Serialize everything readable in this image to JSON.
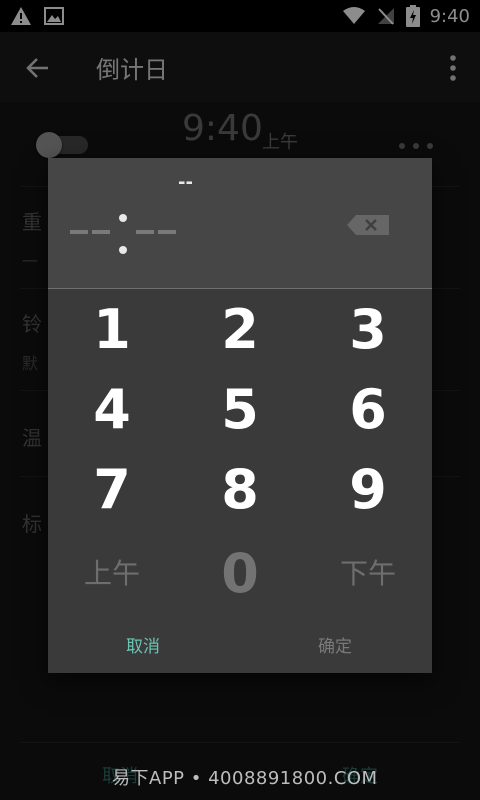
{
  "status_bar": {
    "time": "9:40"
  },
  "app_bar": {
    "title": "倒计日"
  },
  "alarm": {
    "time": "9:40",
    "ampm": "上午"
  },
  "background_rows": [
    {
      "label": "重",
      "sub": "一"
    },
    {
      "label": "铃",
      "sub": "默"
    },
    {
      "label": "温"
    },
    {
      "label": "标"
    }
  ],
  "background_actions": {
    "cancel": "取消",
    "ok": "确定"
  },
  "watermark": "易下APP • 4008891800.COM",
  "dialog": {
    "hour_display": "--",
    "keys": [
      "1",
      "2",
      "3",
      "4",
      "5",
      "6",
      "7",
      "8",
      "9"
    ],
    "am_label": "上午",
    "zero": "0",
    "pm_label": "下午",
    "cancel": "取消",
    "ok": "确定"
  },
  "colors": {
    "accent": "#6dc3b3",
    "dialog_bg": "#3a3a3a",
    "dialog_header": "#464646"
  }
}
